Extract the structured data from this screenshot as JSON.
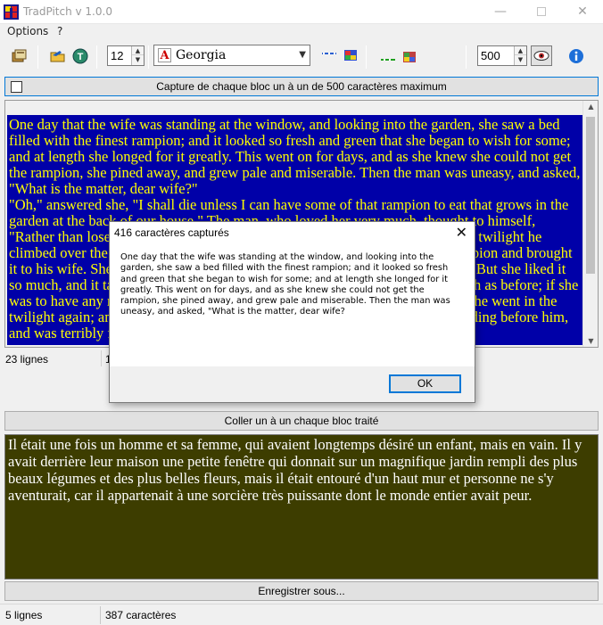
{
  "window": {
    "title": "TradPitch v 1.0.0",
    "min_glyph": "—",
    "close_glyph": "✕"
  },
  "menu": {
    "options": "Options",
    "help": "?"
  },
  "toolbar": {
    "font_size": "12",
    "font_name": "Georgia",
    "font_icon_glyph": "A",
    "block_size": "500",
    "icons": [
      "open-file-icon",
      "folder-icon",
      "translate-icon",
      "text-color-icon",
      "background-color-icon",
      "output-text-color-icon",
      "output-background-color-icon",
      "preview-icon",
      "info-icon"
    ]
  },
  "capture_button": {
    "label": "Capture de chaque bloc un à un de 500 caractères maximum"
  },
  "source_text": "One day that the wife was standing at the window, and looking into the garden, she saw a bed filled with the finest rampion; and it looked so fresh and green that she began to wish for some; and at length she longed for it greatly. This went on for days, and as she knew she could not get the rampion, she pined away, and grew pale and miserable. Then the man was uneasy, and asked, \"What is the matter, dear wife?\"\n\"Oh,\" answered she, \"I shall die unless I can have some of that rampion to eat that grows in the garden at the back of our house.\" The man, who loved her very much, thought to himself, \"Rather than lose my wife I will get some rampion, cost what it will.\" So in the twilight he climbed over the wall into the witch's garden, plucked hastily a handful of rampion and brought it to his wife. She made a salad of it at once, and ate of it to her heart's content. But she liked it so much, and it tasted so good, that the next day she longed for it thrice as much as before; if she was to have any rest the man knew he must climb over the wall once more. So he went in the twilight again; and as he was climbing back, he saw, all at once, the witch standing before him, and was terribly frightened, as she cried, with",
  "status_top": {
    "lines": "23 lignes",
    "chars": "1"
  },
  "dialog": {
    "title": "416 caractères capturés",
    "message": "One day that the wife was standing at the window, and looking into the garden, she saw a bed filled with the finest rampion; and it looked so fresh and green that she began to wish for some; and at length she longed for it greatly. This went on for days, and as she knew she could not get the rampion, she pined away, and grew pale and miserable. Then the man was uneasy, and asked, \"What is the matter, dear wife?",
    "ok": "OK"
  },
  "paste_button": {
    "label": "Coller un à un chaque bloc traité"
  },
  "output_text": "Il était une fois un homme et sa femme, qui avaient longtemps désiré un enfant, mais en vain. Il y avait derrière leur maison une petite fenêtre qui donnait sur un magnifique jardin rempli des plus beaux légumes et des plus belles fleurs, mais il était entouré d'un haut mur et personne ne s'y aventurait, car il appartenait à une sorcière très puissante dont le monde entier avait peur.",
  "save_button": {
    "label": "Enregistrer sous..."
  },
  "status_bottom": {
    "lines": "5 lignes",
    "chars": "387 caractères"
  },
  "colors": {
    "source_bg": "#0000a8",
    "source_fg": "#ffff00",
    "output_bg": "#3d3d00",
    "output_fg": "#ffffff",
    "accent": "#0078d7"
  }
}
